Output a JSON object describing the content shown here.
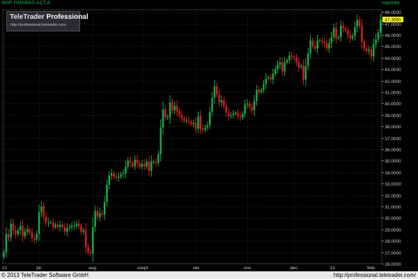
{
  "header": {
    "series_label": "BNP PARIBAS ACT.A",
    "period_label": "naponta"
  },
  "logo": {
    "title": "TeleTrader",
    "title_suffix": "Professional",
    "url": "http://professional.teletrader.com"
  },
  "footer": {
    "copyright": "© 2013 TeleTrader Software GmbH",
    "url": "http://professional.teletrader.com/"
  },
  "colors": {
    "background": "#000000",
    "grid": "#2a2a2a",
    "up": "#19b24a",
    "down": "#e01e1e",
    "axis_text": "#cccccc",
    "last_price_bg": "#ffff00"
  },
  "chart_data": {
    "type": "candlestick",
    "grid": true,
    "y_axis_side": "right",
    "ylim": [
      26.0,
      48.2
    ],
    "y_ticks": [
      26.0,
      27.0,
      28.0,
      29.0,
      30.0,
      31.0,
      32.0,
      33.0,
      34.0,
      35.0,
      36.0,
      37.0,
      38.0,
      39.0,
      40.0,
      41.0,
      42.0,
      43.0,
      44.0,
      45.0,
      46.0,
      47.0,
      48.0
    ],
    "y_tick_labels": [
      "26.0000",
      "27.0000",
      "28.0000",
      "29.0000",
      "30.0000",
      "31.0000",
      "32.0000",
      "33.0000",
      "34.0000",
      "35.0000",
      "36.0000",
      "37.0000",
      "38.0000",
      "39.0000",
      "40.0000",
      "41.0000",
      "42.0000",
      "43.0000",
      "44.0000",
      "45.0000",
      "46.0000",
      "47.0000",
      "48.0000"
    ],
    "last_price": 47.35,
    "last_price_label": "47.3550",
    "x_labels": [
      "12",
      "júl.",
      "aug.",
      "szept",
      "okt",
      "nov.",
      "dec.",
      "'13",
      "febr."
    ],
    "x_label_bars": [
      0,
      15,
      38,
      59,
      82,
      104,
      124,
      140,
      157
    ],
    "closes": [
      27.0,
      28.6,
      28.3,
      29.5,
      28.9,
      28.6,
      28.9,
      29.3,
      28.4,
      28.8,
      29.0,
      28.7,
      28.2,
      28.1,
      28.6,
      30.5,
      31.0,
      30.1,
      29.6,
      29.6,
      29.6,
      29.2,
      29.4,
      29.2,
      29.4,
      29.2,
      28.8,
      29.1,
      29.2,
      29.3,
      29.3,
      29.5,
      29.3,
      28.8,
      28.9,
      27.5,
      27.0,
      26.9,
      29.2,
      30.6,
      30.1,
      30.4,
      30.3,
      31.4,
      32.9,
      33.7,
      33.9,
      33.6,
      33.5,
      33.6,
      33.8,
      33.9,
      34.5,
      35.0,
      34.8,
      34.5,
      35.1,
      34.8,
      34.5,
      34.7,
      34.5,
      34.9,
      34.1,
      34.9,
      34.9,
      34.8,
      35.6,
      37.9,
      39.5,
      38.8,
      38.8,
      40.1,
      39.4,
      39.8,
      39.3,
      39.0,
      38.7,
      38.5,
      38.5,
      38.4,
      38.2,
      38.3,
      37.8,
      38.9,
      37.8,
      37.7,
      37.9,
      38.1,
      39.3,
      40.5,
      41.5,
      40.8,
      40.1,
      40.3,
      39.8,
      39.2,
      38.9,
      39.0,
      39.1,
      39.2,
      38.9,
      38.8,
      39.1,
      39.9,
      40.0,
      39.7,
      39.4,
      40.2,
      41.2,
      41.0,
      41.2,
      41.7,
      42.2,
      42.3,
      42.1,
      42.6,
      43.0,
      43.4,
      43.6,
      42.8,
      43.6,
      43.8,
      44.2,
      44.1,
      44.0,
      43.6,
      43.2,
      43.3,
      42.1,
      43.3,
      44.4,
      45.5,
      45.0,
      44.8,
      45.5,
      45.5,
      45.4,
      45.3,
      44.8,
      45.3,
      45.8,
      46.6,
      45.7,
      45.8,
      46.8,
      46.6,
      46.4,
      46.0,
      45.7,
      45.9,
      46.7,
      47.3,
      46.8,
      45.4,
      44.8,
      44.6,
      44.7,
      44.1,
      45.2,
      45.6,
      46.2,
      47.35
    ]
  }
}
